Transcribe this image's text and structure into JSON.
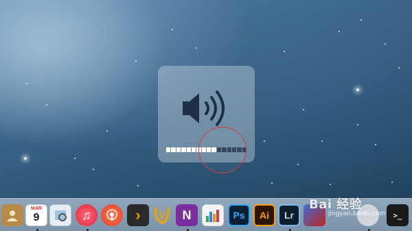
{
  "volume_hud": {
    "level": 0.6,
    "total_segments": 16,
    "icon": "speaker-volume-icon"
  },
  "dock": {
    "apps": [
      {
        "name": "contacts-icon",
        "label": ""
      },
      {
        "name": "calendar-icon",
        "label": "9",
        "month": "MAR"
      },
      {
        "name": "preview-icon",
        "label": ""
      },
      {
        "name": "itunes-icon",
        "label": "♫"
      },
      {
        "name": "podcasts-icon",
        "label": ""
      },
      {
        "name": "plex-icon",
        "label": "›"
      },
      {
        "name": "alfred-icon",
        "label": ""
      },
      {
        "name": "onenote-icon",
        "label": "N"
      },
      {
        "name": "numbers-icon",
        "label": ""
      },
      {
        "name": "photoshop-icon",
        "label": "Ps"
      },
      {
        "name": "illustrator-icon",
        "label": "Ai"
      },
      {
        "name": "lightroom-icon",
        "label": "Lr"
      },
      {
        "name": "app-icon-red",
        "label": ""
      },
      {
        "name": "app-icon-grey",
        "label": ""
      },
      {
        "name": "terminal-icon",
        "label": ">_"
      }
    ]
  },
  "watermark": {
    "main": "Bai 经验",
    "sub": "jingyan.baidu.com"
  },
  "colors": {
    "highlight_circle": "#d33a3a",
    "bar_on": "#ffffff",
    "bar_off": "#2c3e57"
  }
}
